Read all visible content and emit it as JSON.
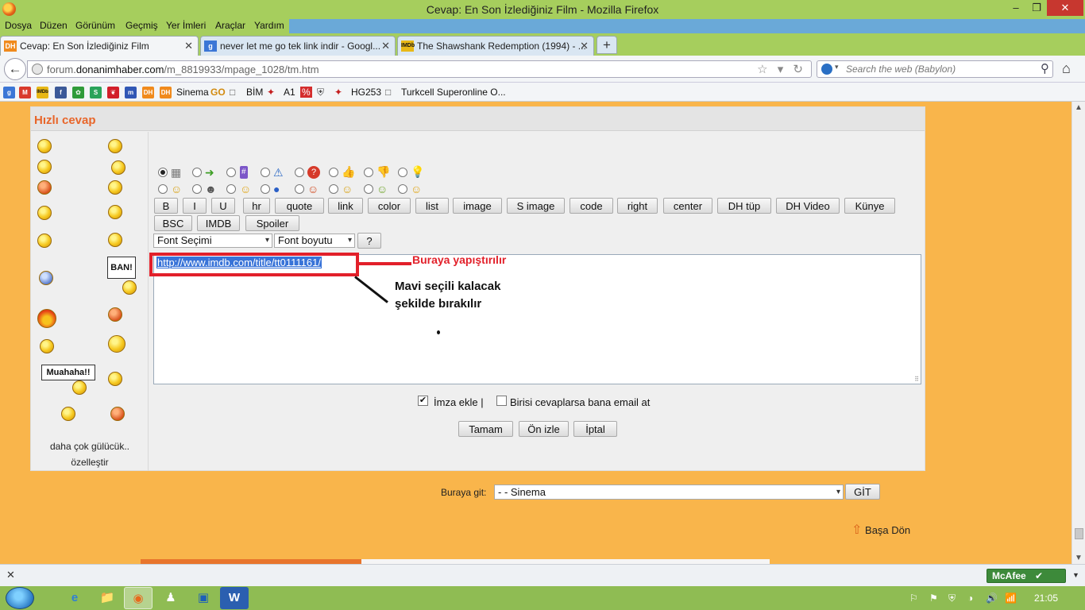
{
  "window": {
    "title": "Cevap: En Son İzlediğiniz Film - Mozilla Firefox",
    "min": "–",
    "max": "❐",
    "close": "✕"
  },
  "menubar": [
    "Dosya",
    "Düzen",
    "Görünüm",
    "Geçmiş",
    "Yer İmleri",
    "Araçlar",
    "Yardım"
  ],
  "tabs": [
    {
      "icon": "DH",
      "icon_color": "#f08a1c",
      "label": "Cevap: En Son İzlediğiniz Film",
      "close": "✕"
    },
    {
      "icon": "g",
      "icon_color": "#3b76d6",
      "label": "never let me go tek link indir - Googl...",
      "close": "✕"
    },
    {
      "icon": "IMDb",
      "icon_color": "#e8b816",
      "label": "The Shawshank Redemption (1994) - ...",
      "close": "✕"
    }
  ],
  "newtab": "+",
  "nav": {
    "back": "←",
    "url_prefix": "forum.",
    "url_domain": "donanimhaber.com",
    "url_path": "/m_8819933/mpage_1028/tm.htm",
    "url_icons": "☆ ▾ ↻",
    "search_placeholder": "Search the web (Babylon)",
    "search_drop": "▾",
    "search_icon": "⚲",
    "home": "⌂"
  },
  "bookmarks": {
    "icons": [
      {
        "text": "g",
        "color": "#3b76d6"
      },
      {
        "text": "M",
        "color": "#d93a2c"
      },
      {
        "text": "IMDb",
        "color": "#e8b816"
      },
      {
        "text": "f",
        "color": "#3b5998"
      },
      {
        "text": "✿",
        "color": "#2f9b3a"
      },
      {
        "text": "S",
        "color": "#2aa35a"
      },
      {
        "text": "❦",
        "color": "#d21f2b"
      },
      {
        "text": "m",
        "color": "#3157b5"
      },
      {
        "text": "DH",
        "color": "#f08a1c"
      },
      {
        "text": "DH",
        "color": "#f08a1c"
      }
    ],
    "labels": [
      "Sinema",
      "BİM",
      "A1",
      "HG253",
      "Turkcell Superonline O..."
    ],
    "small_icons": [
      "GO",
      "□",
      "✦",
      "%",
      "⛨",
      "✦",
      "□"
    ]
  },
  "reply": {
    "title": "Hızlı cevap",
    "more_smileys": "daha çok gülücük..",
    "customize": "özelleştir",
    "ban_sign": "BAN!",
    "muahaha_sign": "Muahaha!!",
    "post_icons_row1": [
      "▦",
      "➜",
      "#",
      "⚠",
      "?",
      "👍",
      "👎",
      "💡"
    ],
    "post_icons_row2": [
      "☺",
      "☻",
      "☺",
      "●",
      "☺",
      "☺",
      "☺",
      "☺"
    ],
    "format_buttons": [
      "B",
      "I",
      "U",
      "hr",
      "quote",
      "link",
      "color",
      "list",
      "image",
      "S image",
      "code",
      "right",
      "center",
      "DH tüp",
      "DH Video",
      "Künye"
    ],
    "format_buttons_row2": [
      "BSC",
      "IMDB",
      "Spoiler"
    ],
    "font_select": "Font Seçimi",
    "size_select": "Font boyutu",
    "help_button": "?",
    "textarea_value": "http://www.imdb.com/title/tt0111161/",
    "resize_grip": "⠿",
    "annotation_paste": "Buraya yapıştırılır",
    "annotation_note_line1": "Mavi seçili kalacak",
    "annotation_note_line2": "şekilde bırakılır",
    "sign_checked": "✔",
    "sign_label": "İmza ekle |",
    "email_label": "Birisi cevaplarsa bana email at",
    "ok_button": "Tamam",
    "preview_button": "Ön izle",
    "cancel_button": "İptal"
  },
  "goto": {
    "label": "Buraya git:",
    "value": "- - Sinema",
    "button": "GİT",
    "arrow": "▾"
  },
  "back_to_top": {
    "arrow": "⇧",
    "label": "Başa Dön"
  },
  "scroll": {
    "up": "▲",
    "down": "▼"
  },
  "addonbar": {
    "close": "✕",
    "mcafee": "McAfee",
    "mcafee_check": "✔",
    "drop": "▼"
  },
  "taskbar": {
    "apps": [
      "e",
      "📁",
      "◉",
      "♟",
      "▣",
      "W"
    ],
    "tray": [
      "⚐",
      "⚑",
      "⛨",
      "◑",
      "🔊",
      "📶"
    ],
    "clock": "21:05"
  }
}
